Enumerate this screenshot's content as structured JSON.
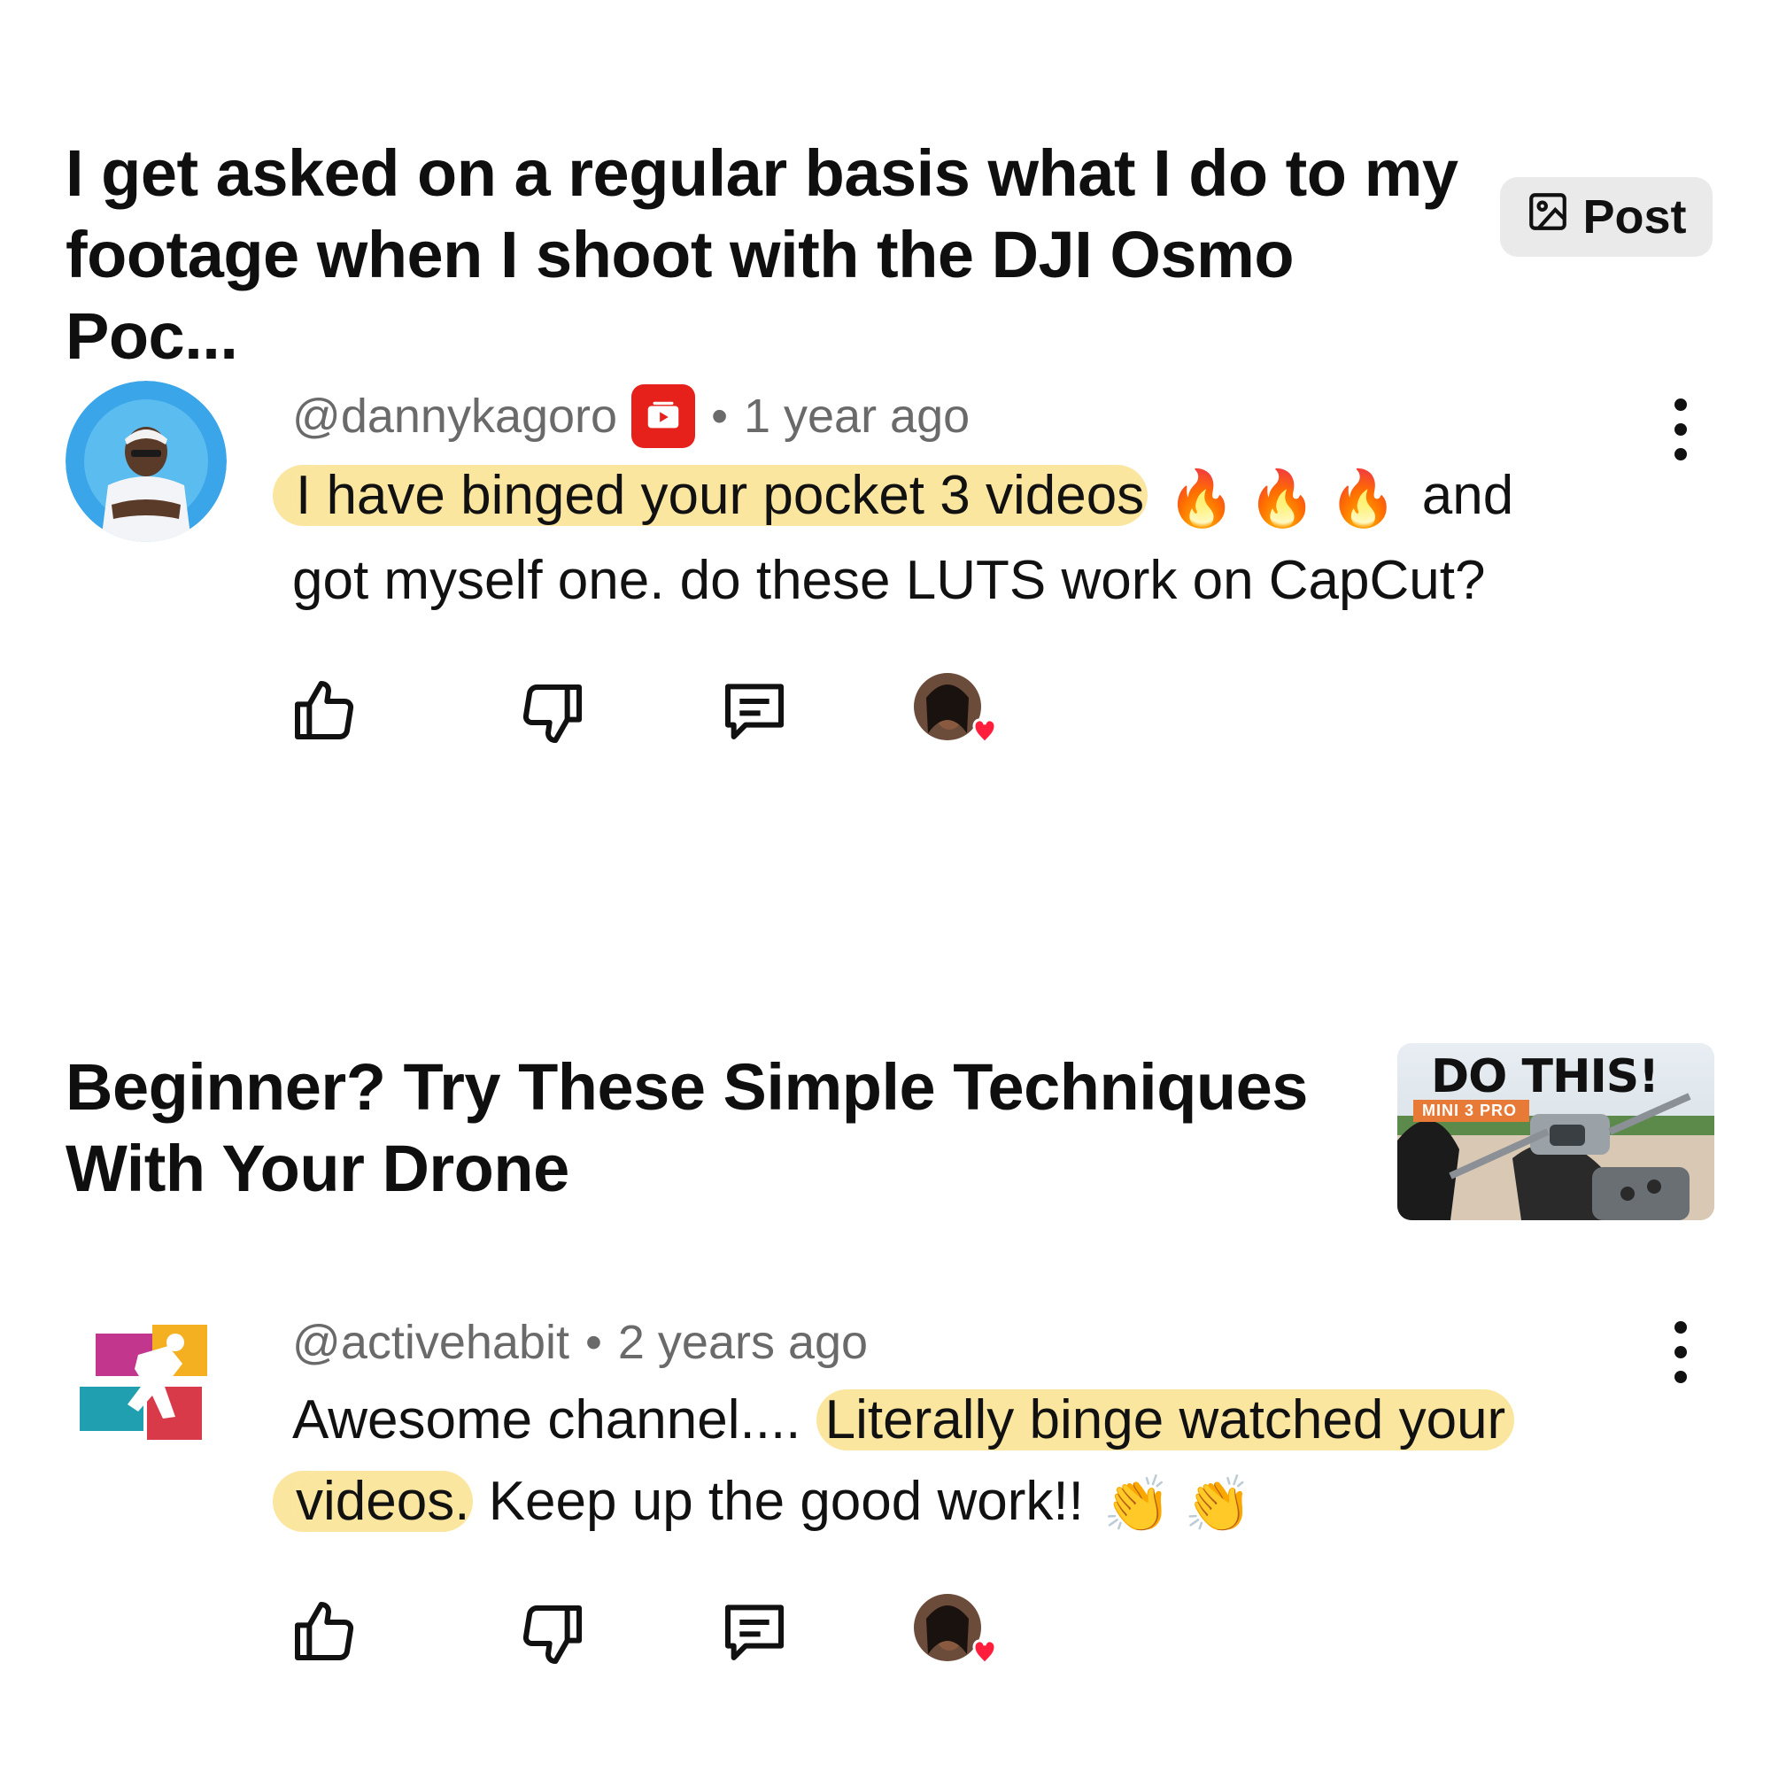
{
  "post_card": {
    "title_line1": "I get asked on a regular basis what I do to my",
    "title_line2": "footage when I shoot with the DJI Osmo Poc...",
    "badge_label": "Post"
  },
  "comment1": {
    "author": "@dannykagoro",
    "separator": "•",
    "time": "1 year ago",
    "text_highlight": "I have binged your pocket 3 videos",
    "emojis": "🔥🔥🔥",
    "text_after_emojis": "and",
    "text_line2": "got myself one. do these LUTS work on CapCut?"
  },
  "video_card": {
    "title_line1": "Beginner? Try These Simple Techniques",
    "title_line2": "With Your Drone",
    "thumbnail_title": "DO THIS!",
    "thumbnail_tag": "MINI 3 PRO"
  },
  "comment2": {
    "author": "@activehabit",
    "separator": "•",
    "time": "2 years ago",
    "text_plain": "Awesome channel....",
    "text_highlight_a": "Literally binge watched your",
    "text_highlight_b": "videos.",
    "text_rest": "Keep up the good work!!",
    "emojis": "👏👏"
  },
  "icons": {
    "like": "thumbs-up-icon",
    "dislike": "thumbs-down-icon",
    "reply": "comment-icon",
    "hearted": "creator-heart-avatar",
    "more": "more-vert-icon",
    "post": "image-icon"
  },
  "colors": {
    "highlight": "#fbe6a0",
    "youtube_red": "#e6201b",
    "heart_red": "#ff1f3d",
    "meta_gray": "#6a6a6a"
  }
}
